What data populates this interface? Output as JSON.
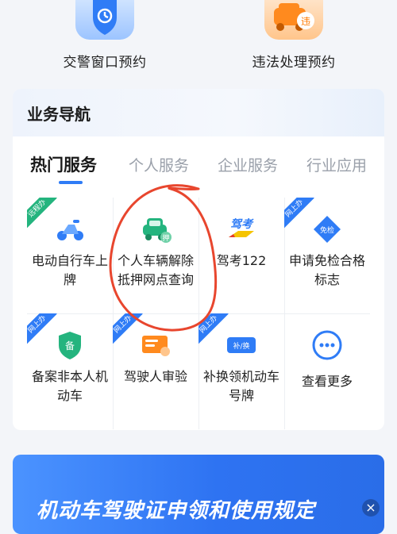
{
  "quick_actions": [
    {
      "label": "交警窗口预约",
      "icon": "police-shield-icon"
    },
    {
      "label": "违法处理预约",
      "icon": "violation-car-icon"
    }
  ],
  "nav": {
    "title": "业务导航",
    "tabs": [
      "热门服务",
      "个人服务",
      "企业服务",
      "行业应用"
    ],
    "services": [
      {
        "label": "电动自行车上牌",
        "badge": "远程办",
        "icon": "e-bike-icon"
      },
      {
        "label": "个人车辆解除抵押网点查询",
        "badge": "",
        "icon": "car-lien-icon"
      },
      {
        "label": "驾考122",
        "badge": "",
        "icon": "driving-test-icon",
        "icon_text": "驾考"
      },
      {
        "label": "申请免检合格标志",
        "badge": "网上办",
        "icon": "inspection-exempt-icon",
        "icon_text": "免检"
      },
      {
        "label": "备案非本人机动车",
        "badge": "网上办",
        "icon": "record-shield-icon",
        "icon_text": "备"
      },
      {
        "label": "驾驶人审验",
        "badge": "网上办",
        "icon": "license-card-icon"
      },
      {
        "label": "补换领机动车号牌",
        "badge": "网上办",
        "icon": "plate-replace-icon",
        "icon_text": "补/换"
      },
      {
        "label": "查看更多",
        "badge": "",
        "icon": "more-dots-icon"
      }
    ]
  },
  "banner": {
    "title": "机动车驾驶证申领和使用规定"
  },
  "colors": {
    "accent": "#2f7cf6",
    "annotation": "#e8462e",
    "badge_green": "#24b47e"
  }
}
